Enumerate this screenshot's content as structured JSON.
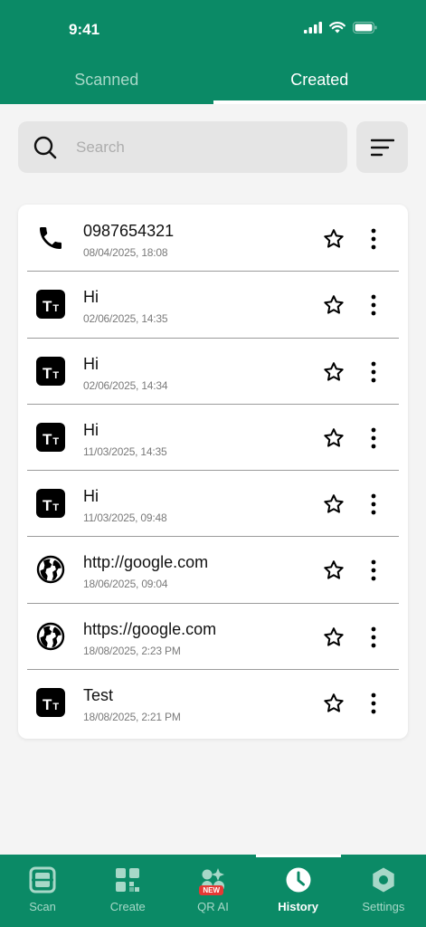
{
  "status_bar": {
    "time": "9:41"
  },
  "tabs": [
    {
      "label": "Scanned",
      "active": false
    },
    {
      "label": "Created",
      "active": true
    }
  ],
  "search": {
    "placeholder": "Search"
  },
  "items": [
    {
      "type": "phone",
      "icon": "phone-icon",
      "title": "0987654321",
      "date": "08/04/2025, 18:08"
    },
    {
      "type": "text",
      "icon": "text-icon",
      "title": "Hi",
      "date": "02/06/2025, 14:35"
    },
    {
      "type": "text",
      "icon": "text-icon",
      "title": "Hi",
      "date": "02/06/2025, 14:34"
    },
    {
      "type": "text",
      "icon": "text-icon",
      "title": "Hi",
      "date": "11/03/2025, 14:35"
    },
    {
      "type": "text",
      "icon": "text-icon",
      "title": "Hi",
      "date": "11/03/2025, 09:48"
    },
    {
      "type": "url",
      "icon": "globe-icon",
      "title": "http://google.com",
      "date": "18/06/2025, 09:04"
    },
    {
      "type": "url",
      "icon": "globe-icon",
      "title": "https://google.com",
      "date": "18/08/2025, 2:23 PM"
    },
    {
      "type": "text",
      "icon": "text-icon",
      "title": "Test",
      "date": "18/08/2025, 2:21 PM"
    }
  ],
  "bottom_nav": [
    {
      "label": "Scan",
      "icon": "scan-icon",
      "active": false
    },
    {
      "label": "Create",
      "icon": "create-icon",
      "active": false
    },
    {
      "label": "QR AI",
      "icon": "qr-ai-icon",
      "active": false,
      "badge": "NEW"
    },
    {
      "label": "History",
      "icon": "clock-icon",
      "active": true
    },
    {
      "label": "Settings",
      "icon": "settings-icon",
      "active": false
    }
  ],
  "colors": {
    "brand": "#0b8a66",
    "inactive_text": "#a7d8c8",
    "badge": "#e53935"
  }
}
